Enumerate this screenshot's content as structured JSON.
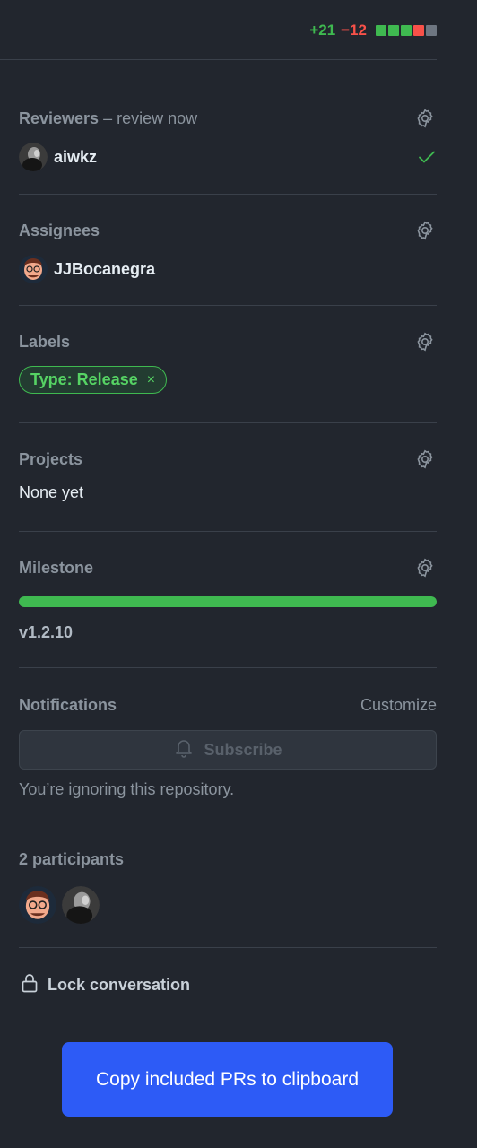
{
  "diffstat": {
    "additions": "+21",
    "deletions": "−12",
    "blocks": [
      "#3fb950",
      "#3fb950",
      "#3fb950",
      "#f85149",
      "#6e7681"
    ]
  },
  "reviewers": {
    "title": "Reviewers",
    "suffix": " – review now",
    "users": [
      {
        "name": "aiwkz",
        "status": "approved"
      }
    ]
  },
  "assignees": {
    "title": "Assignees",
    "users": [
      {
        "name": "JJBocanegra"
      }
    ]
  },
  "labels": {
    "title": "Labels",
    "items": [
      {
        "name": "Type: Release",
        "remove": "×",
        "color": "#3fb950"
      }
    ]
  },
  "projects": {
    "title": "Projects",
    "value": "None yet"
  },
  "milestone": {
    "title": "Milestone",
    "progress": 1.0,
    "name": "v1.2.10"
  },
  "notifications": {
    "title": "Notifications",
    "customize": "Customize",
    "button": "Subscribe",
    "status": "You’re ignoring this repository."
  },
  "participants": {
    "title": "2 participants",
    "avatars": [
      "JJBocanegra",
      "aiwkz"
    ]
  },
  "lock": {
    "label": "Lock conversation"
  },
  "copy_button": {
    "label": "Copy included PRs to clipboard"
  },
  "colors": {
    "background": "#22262e",
    "accent": "#2d5bf6",
    "success": "#3fb950",
    "danger": "#f85149"
  }
}
